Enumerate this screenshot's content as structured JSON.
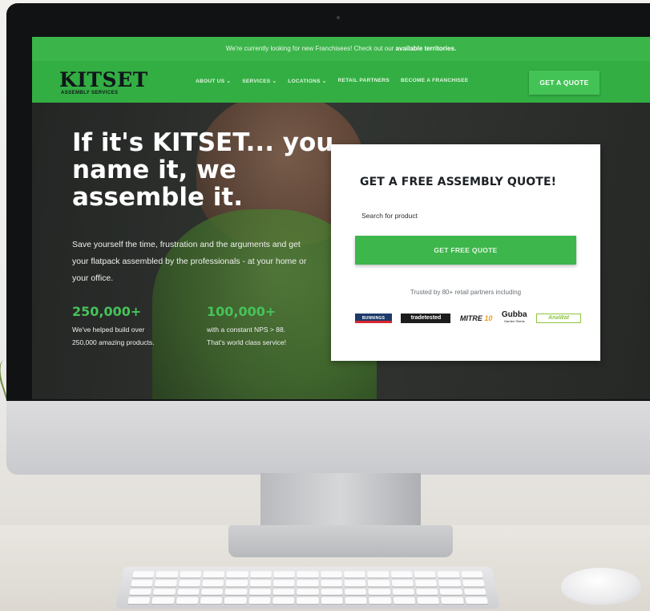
{
  "announcement": {
    "text": "We're currently looking for new Franchisees! Check out our ",
    "link": "available territories."
  },
  "nav": {
    "logo": "KITSET",
    "logo_sub": "ASSEMBLY SERVICES",
    "items": [
      {
        "label": "ABOUT US ⌄"
      },
      {
        "label": "SERVICES ⌄"
      },
      {
        "label": "LOCATIONS ⌄"
      },
      {
        "label": "RETAIL PARTNERS"
      },
      {
        "label": "BECOME A FRANCHISEE"
      }
    ],
    "cta": "GET A QUOTE"
  },
  "hero": {
    "title": "If it's KITSET... you name it, we assemble it.",
    "description": "Save yourself the time, frustration and the arguments and get your flatpack assembled by the professionals - at your home or your office.",
    "stats": [
      {
        "number": "250,000+",
        "line1": "We've helped build over",
        "line2": "250,000 amazing products."
      },
      {
        "number": "100,000+",
        "line1": "with a constant NPS > 88.",
        "line2": "That's world class service!"
      }
    ]
  },
  "quote_card": {
    "title": "GET A FREE ASSEMBLY QUOTE!",
    "search_label": "Search for product",
    "search_placeholder": "",
    "cta": "GET FREE QUOTE",
    "trusted": "Trusted by 80+ retail partners including",
    "partners": {
      "bunnings": "BUNNINGS",
      "tradetested": "tradetested",
      "mitre_prefix": "MITRE ",
      "mitre_suffix": "10",
      "gubba": "Gubba",
      "gubba_sub": "Garden Sheds",
      "last": "AnaWat"
    }
  },
  "colors": {
    "brand_green": "#3bb54a",
    "nav_green": "#33ae43",
    "button_green": "#3db64c",
    "stat_green": "#47c25a"
  }
}
